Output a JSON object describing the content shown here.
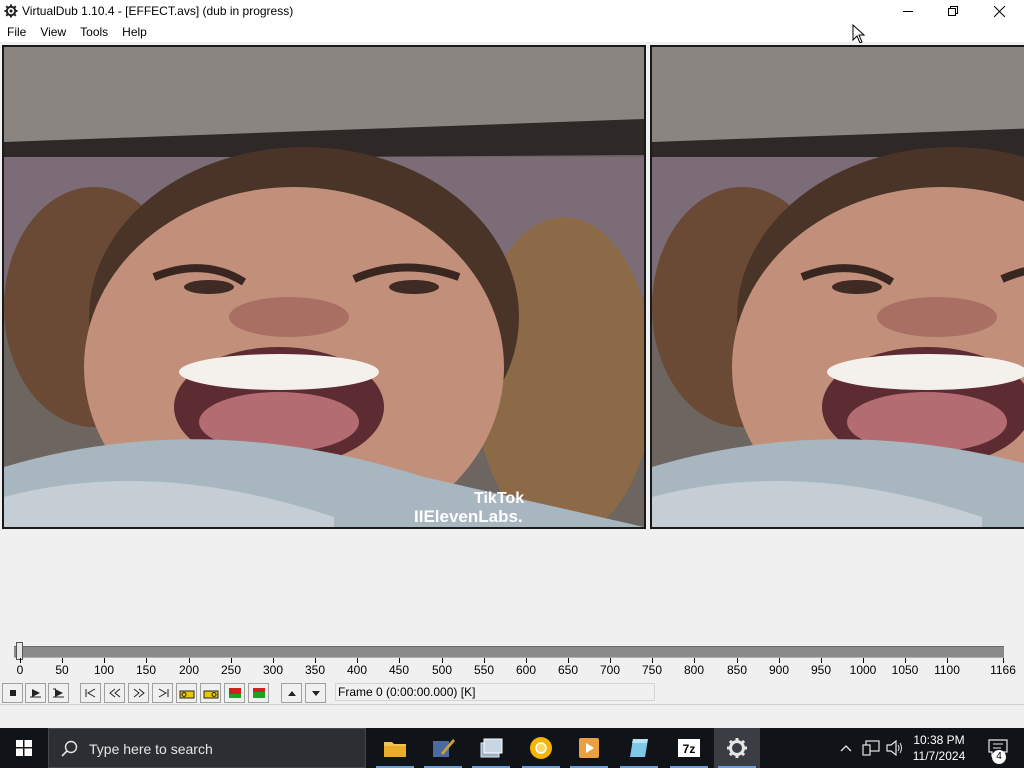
{
  "window": {
    "title": "VirtualDub 1.10.4 - [EFFECT.avs] (dub in progress)",
    "app_icon": "gear-icon"
  },
  "menu": {
    "items": [
      {
        "label": "File"
      },
      {
        "label": "View"
      },
      {
        "label": "Tools"
      },
      {
        "label": "Help"
      }
    ]
  },
  "video": {
    "watermark_brand": "TikTok",
    "watermark_user": "IIElevenLabs."
  },
  "timeline": {
    "ticks": [
      "0",
      "50",
      "100",
      "150",
      "200",
      "250",
      "300",
      "350",
      "400",
      "450",
      "500",
      "550",
      "600",
      "650",
      "700",
      "750",
      "800",
      "850",
      "900",
      "950",
      "1000",
      "1050",
      "1100",
      "1166"
    ],
    "position": 0,
    "max": 1166
  },
  "toolbar": {
    "frame_display": "Frame 0 (0:00:00.000) [K]"
  },
  "taskbar": {
    "search_placeholder": "Type here to search",
    "clock_time": "10:38 PM",
    "clock_date": "11/7/2024",
    "notification_count": "4"
  },
  "colors": {
    "taskbar_bg": "#101418",
    "accent": "#6aa0d8"
  }
}
